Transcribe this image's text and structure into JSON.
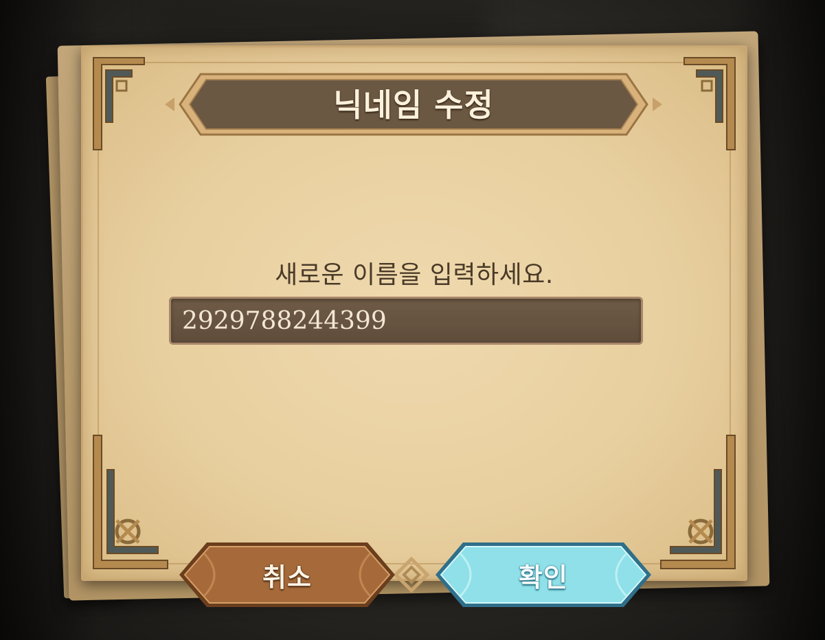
{
  "dialog": {
    "title": "닉네임 수정",
    "prompt": "새로운 이름을 입력하세요.",
    "nickname_input": {
      "value": "2929788244399"
    },
    "buttons": {
      "cancel_label": "취소",
      "confirm_label": "확인"
    }
  },
  "colors": {
    "paper": "#e8cf9f",
    "banner": "#6b5842",
    "input_bg": "#66533f",
    "cancel_button": "#9a6236",
    "confirm_button": "#8fe0e8"
  },
  "icons": {
    "corner_ornament": "celtic-knot-corner-icon",
    "divider_ornament": "knot-ornament-icon"
  }
}
